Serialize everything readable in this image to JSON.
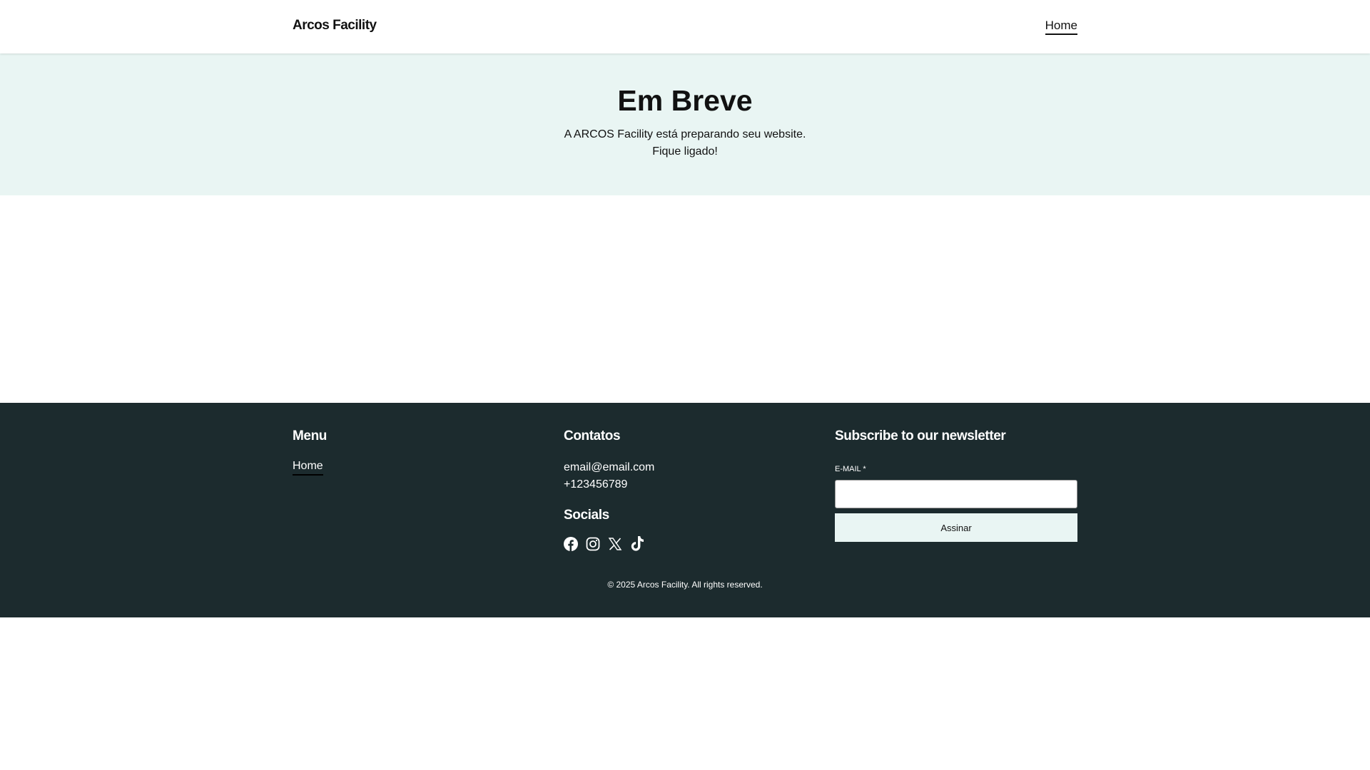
{
  "header": {
    "brand": "Arcos Facility",
    "nav": [
      {
        "label": "Home"
      }
    ]
  },
  "hero": {
    "title": "Em Breve",
    "line1": "A ARCOS Facility está preparando seu website.",
    "line2": "Fique ligado!"
  },
  "footer": {
    "menu": {
      "title": "Menu",
      "items": [
        {
          "label": "Home"
        }
      ]
    },
    "contacts": {
      "title": "Contatos",
      "email": "email@email.com",
      "phone": "+123456789"
    },
    "socials": {
      "title": "Socials",
      "icons": [
        "facebook-icon",
        "instagram-icon",
        "x-icon",
        "tiktok-icon"
      ]
    },
    "newsletter": {
      "title": "Subscribe to our newsletter",
      "label": "E-MAIL *",
      "email_value": "",
      "button": "Assinar"
    },
    "copyright": "© 2025 Arcos Facility. All rights reserved."
  }
}
